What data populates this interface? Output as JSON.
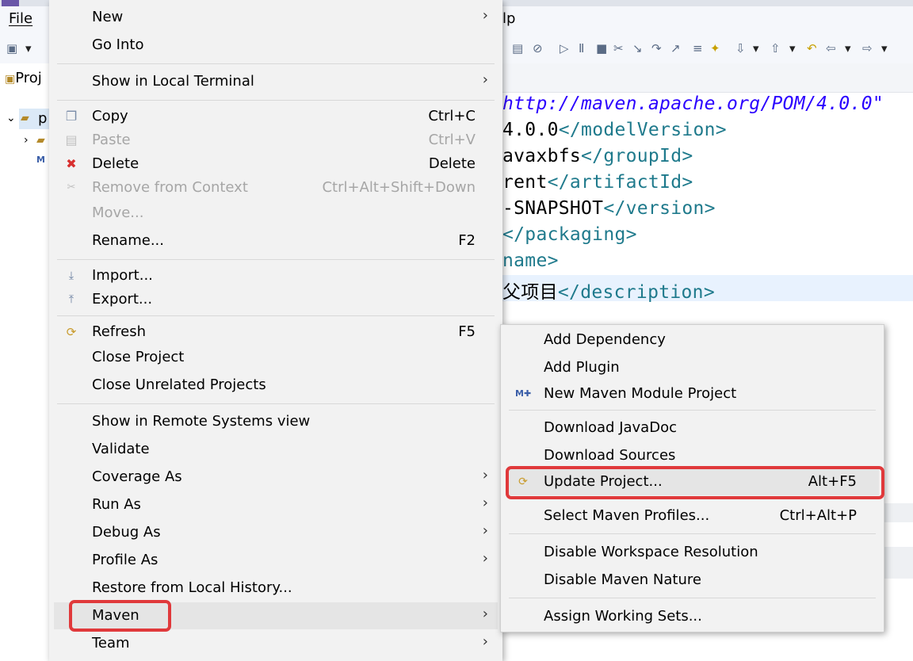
{
  "menubar": {
    "file": "File",
    "help_fragment": "lp"
  },
  "project_tab": "Proj",
  "tree_fragment": "p",
  "code_lines": [
    {
      "parts": [
        {
          "t": "str",
          "v": "http://maven.apache.org/POM/4.0.0\""
        }
      ]
    },
    {
      "parts": [
        {
          "t": "txt",
          "v": "4.0.0"
        },
        {
          "t": "tag",
          "v": "</modelVersion>"
        }
      ]
    },
    {
      "parts": [
        {
          "t": "txt",
          "v": "avaxbfs"
        },
        {
          "t": "tag",
          "v": "</groupId>"
        }
      ]
    },
    {
      "parts": [
        {
          "t": "txt",
          "v": "rent"
        },
        {
          "t": "tag",
          "v": "</artifactId>"
        }
      ]
    },
    {
      "parts": [
        {
          "t": "txt",
          "v": "-SNAPSHOT"
        },
        {
          "t": "tag",
          "v": "</version>"
        }
      ]
    },
    {
      "parts": [
        {
          "t": "tag",
          "v": "</packaging>"
        }
      ]
    },
    {
      "parts": [
        {
          "t": "tag",
          "v": "name>"
        }
      ]
    },
    {
      "parts": [
        {
          "t": "txt",
          "v": "父项目"
        },
        {
          "t": "tag",
          "v": "</description>"
        }
      ]
    }
  ],
  "context_menu": {
    "new": "New",
    "go_into": "Go Into",
    "show_local_terminal": "Show in Local Terminal",
    "copy": "Copy",
    "copy_accel": "Ctrl+C",
    "paste": "Paste",
    "paste_accel": "Ctrl+V",
    "delete": "Delete",
    "delete_accel": "Delete",
    "remove_context": "Remove from Context",
    "remove_context_accel": "Ctrl+Alt+Shift+Down",
    "move": "Move...",
    "rename": "Rename...",
    "rename_accel": "F2",
    "import": "Import...",
    "export": "Export...",
    "refresh": "Refresh",
    "refresh_accel": "F5",
    "close_project": "Close Project",
    "close_unrelated": "Close Unrelated Projects",
    "show_remote": "Show in Remote Systems view",
    "validate": "Validate",
    "coverage_as": "Coverage As",
    "run_as": "Run As",
    "debug_as": "Debug As",
    "profile_as": "Profile As",
    "restore_history": "Restore from Local History...",
    "maven": "Maven",
    "team": "Team"
  },
  "maven_submenu": {
    "add_dependency": "Add Dependency",
    "add_plugin": "Add Plugin",
    "new_module": "New Maven Module Project",
    "download_javadoc": "Download JavaDoc",
    "download_sources": "Download Sources",
    "update_project": "Update Project...",
    "update_project_accel": "Alt+F5",
    "select_profiles": "Select Maven Profiles...",
    "select_profiles_accel": "Ctrl+Alt+P",
    "disable_workspace": "Disable Workspace Resolution",
    "disable_nature": "Disable Maven Nature",
    "assign_working_sets": "Assign Working Sets..."
  },
  "colors": {
    "highlight_box": "#e0393b",
    "xml_tag": "#1f7a8c",
    "xml_string": "#2a00ff"
  }
}
